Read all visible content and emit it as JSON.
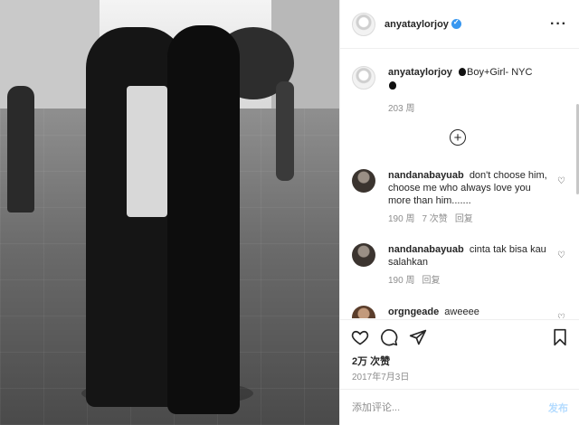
{
  "post": {
    "username": "anyataylorjoy",
    "verified": true
  },
  "caption": {
    "username": "anyataylorjoy",
    "text_part1": "Boy+Girl- NYC",
    "time": "203 周"
  },
  "comments": [
    {
      "username": "nandanabayuab",
      "text": "don't choose him, choose me who always love you more than him.......",
      "time": "190 周",
      "likes": "7 次赞",
      "reply": "回复"
    },
    {
      "username": "nandanabayuab",
      "text": "cinta tak bisa kau salahkan",
      "time": "190 周",
      "reply": "回复"
    },
    {
      "username": "orgngeade",
      "text": "aweeee"
    }
  ],
  "icons": {
    "more": "more-options-icon",
    "like": "heart-icon",
    "comment": "comment-icon",
    "share": "share-icon",
    "save": "bookmark-icon",
    "load_more": "plus-circle-icon"
  },
  "stats": {
    "likes": "2万 次赞",
    "date": "2017年7月3日"
  },
  "comment_box": {
    "placeholder": "添加评论...",
    "post_label": "发布"
  },
  "colors": {
    "verified": "#3897f0",
    "post_button_disabled": "#b3dbff",
    "meta_text": "#8e8e8e"
  }
}
